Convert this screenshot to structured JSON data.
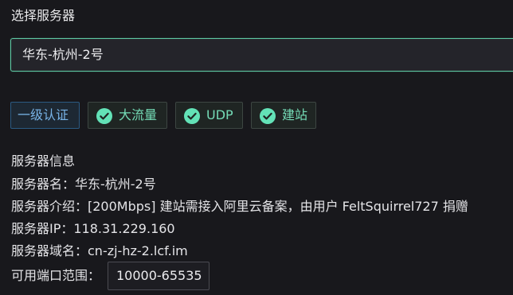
{
  "server_select": {
    "label": "选择服务器",
    "value": "华东-杭州-2号"
  },
  "tags": [
    {
      "label": "一级认证",
      "type": "info"
    },
    {
      "label": "大流量",
      "type": "success",
      "icon": "check-circle-icon"
    },
    {
      "label": "UDP",
      "type": "success",
      "icon": "check-circle-icon"
    },
    {
      "label": "建站",
      "type": "success",
      "icon": "check-circle-icon"
    }
  ],
  "server_info": {
    "title": "服务器信息",
    "name_line": "服务器名：华东-杭州-2号",
    "intro_line": "服务器介绍：[200Mbps] 建站需接入阿里云备案，由用户 FeltSquirrel727 捐赠",
    "ip_line": "服务器IP：118.31.229.160",
    "domain_line": "服务器域名：cn-zj-hz-2.lcf.im",
    "port_label": "可用端口范围：",
    "port_range": "10000-65535"
  },
  "colors": {
    "background": "#18181c",
    "accent_green": "#63e2b7",
    "info_blue": "#70c0e8"
  }
}
